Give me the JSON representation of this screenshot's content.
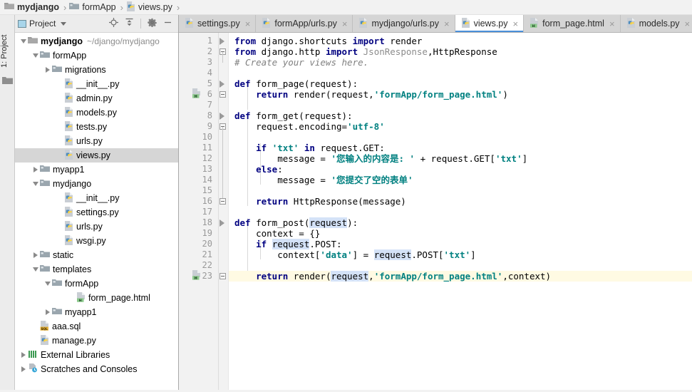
{
  "breadcrumb": {
    "items": [
      {
        "label": "mydjango",
        "icon": "folder-dark-icon"
      },
      {
        "label": "formApp",
        "icon": "folder-blue-icon"
      },
      {
        "label": "views.py",
        "icon": "python-file-icon"
      }
    ],
    "separator": "›"
  },
  "toolstrip": {
    "project_tab_label": "1: Project",
    "folder_icon": "folder-icon"
  },
  "project_panel": {
    "title": "Project",
    "tools": [
      {
        "name": "locate-icon",
        "glyph": "⊕"
      },
      {
        "name": "collapse-all-icon",
        "glyph": "⤓"
      },
      {
        "name": "settings-gear-icon",
        "glyph": "⚙"
      },
      {
        "name": "hide-panel-icon",
        "glyph": "—"
      }
    ],
    "tree": [
      {
        "label": "mydjango",
        "path": "~/django/mydjango",
        "icon": "folder-dark-icon",
        "indent": 0,
        "arrow": "down",
        "bold": true,
        "selected": false
      },
      {
        "label": "formApp",
        "path": "",
        "icon": "folder-blue-icon",
        "indent": 1,
        "arrow": "down",
        "bold": false,
        "selected": false
      },
      {
        "label": "migrations",
        "path": "",
        "icon": "folder-blue-icon",
        "indent": 2,
        "arrow": "right",
        "bold": false,
        "selected": false
      },
      {
        "label": "__init__.py",
        "path": "",
        "icon": "python-file-icon",
        "indent": 3,
        "arrow": "none",
        "bold": false,
        "selected": false
      },
      {
        "label": "admin.py",
        "path": "",
        "icon": "python-file-icon",
        "indent": 3,
        "arrow": "none",
        "bold": false,
        "selected": false
      },
      {
        "label": "models.py",
        "path": "",
        "icon": "python-file-icon",
        "indent": 3,
        "arrow": "none",
        "bold": false,
        "selected": false
      },
      {
        "label": "tests.py",
        "path": "",
        "icon": "python-file-icon",
        "indent": 3,
        "arrow": "none",
        "bold": false,
        "selected": false
      },
      {
        "label": "urls.py",
        "path": "",
        "icon": "python-file-icon",
        "indent": 3,
        "arrow": "none",
        "bold": false,
        "selected": false
      },
      {
        "label": "views.py",
        "path": "",
        "icon": "python-file-icon",
        "indent": 3,
        "arrow": "none",
        "bold": false,
        "selected": true
      },
      {
        "label": "myapp1",
        "path": "",
        "icon": "folder-blue-icon",
        "indent": 1,
        "arrow": "right",
        "bold": false,
        "selected": false
      },
      {
        "label": "mydjango",
        "path": "",
        "icon": "folder-blue-icon",
        "indent": 1,
        "arrow": "down",
        "bold": false,
        "selected": false
      },
      {
        "label": "__init__.py",
        "path": "",
        "icon": "python-file-icon",
        "indent": 3,
        "arrow": "none",
        "bold": false,
        "selected": false
      },
      {
        "label": "settings.py",
        "path": "",
        "icon": "python-file-icon",
        "indent": 3,
        "arrow": "none",
        "bold": false,
        "selected": false
      },
      {
        "label": "urls.py",
        "path": "",
        "icon": "python-file-icon",
        "indent": 3,
        "arrow": "none",
        "bold": false,
        "selected": false
      },
      {
        "label": "wsgi.py",
        "path": "",
        "icon": "python-file-icon",
        "indent": 3,
        "arrow": "none",
        "bold": false,
        "selected": false
      },
      {
        "label": "static",
        "path": "",
        "icon": "folder-blue-icon",
        "indent": 1,
        "arrow": "right",
        "bold": false,
        "selected": false
      },
      {
        "label": "templates",
        "path": "",
        "icon": "folder-blue-icon",
        "indent": 1,
        "arrow": "down",
        "bold": false,
        "selected": false
      },
      {
        "label": "formApp",
        "path": "",
        "icon": "folder-blue-icon",
        "indent": 2,
        "arrow": "down",
        "bold": false,
        "selected": false
      },
      {
        "label": "form_page.html",
        "path": "",
        "icon": "html-file-icon",
        "indent": 4,
        "arrow": "none",
        "bold": false,
        "selected": false
      },
      {
        "label": "myapp1",
        "path": "",
        "icon": "folder-blue-icon",
        "indent": 2,
        "arrow": "right",
        "bold": false,
        "selected": false
      },
      {
        "label": "aaa.sql",
        "path": "",
        "icon": "sql-file-icon",
        "indent": 1,
        "arrow": "none",
        "bold": false,
        "selected": false
      },
      {
        "label": "manage.py",
        "path": "",
        "icon": "python-file-icon",
        "indent": 1,
        "arrow": "none",
        "bold": false,
        "selected": false
      },
      {
        "label": "External Libraries",
        "path": "",
        "icon": "libraries-icon",
        "indent": 0,
        "arrow": "right",
        "bold": false,
        "selected": false
      },
      {
        "label": "Scratches and Consoles",
        "path": "",
        "icon": "scratches-icon",
        "indent": 0,
        "arrow": "right",
        "bold": false,
        "selected": false
      }
    ]
  },
  "editor": {
    "tabs": [
      {
        "label": "settings.py",
        "icon": "python-file-icon",
        "active": false,
        "close": "×"
      },
      {
        "label": "formApp/urls.py",
        "icon": "python-file-icon",
        "active": false,
        "close": "×"
      },
      {
        "label": "mydjango/urls.py",
        "icon": "python-file-icon",
        "active": false,
        "close": "×"
      },
      {
        "label": "views.py",
        "icon": "python-file-icon",
        "active": true,
        "close": "×"
      },
      {
        "label": "form_page.html",
        "icon": "html-file-icon",
        "active": false,
        "close": "×"
      },
      {
        "label": "models.py",
        "icon": "python-file-icon",
        "active": false,
        "close": "×"
      }
    ],
    "caret_line": 23,
    "line_numbers": [
      1,
      2,
      3,
      4,
      5,
      6,
      7,
      8,
      9,
      10,
      11,
      12,
      13,
      14,
      15,
      16,
      17,
      18,
      19,
      20,
      21,
      22,
      23
    ],
    "gutter_markers": [
      {
        "line": 6,
        "name": "html-navigation-marker-icon"
      },
      {
        "line": 23,
        "name": "html-navigation-marker-icon"
      },
      {
        "line": 22,
        "name": "intention-bulb-icon"
      }
    ],
    "lines": [
      {
        "n": 1,
        "tokens": [
          {
            "t": "from",
            "c": "kw"
          },
          {
            "t": " django.shortcuts ",
            "c": "plain"
          },
          {
            "t": "import",
            "c": "kw"
          },
          {
            "t": " render",
            "c": "plain"
          }
        ]
      },
      {
        "n": 2,
        "tokens": [
          {
            "t": "from",
            "c": "kw"
          },
          {
            "t": " django.http ",
            "c": "plain"
          },
          {
            "t": "import",
            "c": "kw"
          },
          {
            "t": " ",
            "c": "plain"
          },
          {
            "t": "JsonResponse",
            "c": "cls"
          },
          {
            "t": ",",
            "c": "plain"
          },
          {
            "t": "HttpResponse",
            "c": "plain"
          }
        ]
      },
      {
        "n": 3,
        "tokens": [
          {
            "t": "# Create your views here.",
            "c": "cmt"
          }
        ]
      },
      {
        "n": 4,
        "tokens": []
      },
      {
        "n": 5,
        "tokens": [
          {
            "t": "def",
            "c": "kw"
          },
          {
            "t": " form_page(request):",
            "c": "plain"
          }
        ]
      },
      {
        "n": 6,
        "tokens": [
          {
            "t": "    ",
            "c": "plain"
          },
          {
            "t": "return",
            "c": "kw"
          },
          {
            "t": " render(request,",
            "c": "plain"
          },
          {
            "t": "'formApp/form_page.html'",
            "c": "str"
          },
          {
            "t": ")",
            "c": "plain"
          }
        ]
      },
      {
        "n": 7,
        "tokens": []
      },
      {
        "n": 8,
        "tokens": [
          {
            "t": "def",
            "c": "kw"
          },
          {
            "t": " form_get(request):",
            "c": "plain"
          }
        ]
      },
      {
        "n": 9,
        "tokens": [
          {
            "t": "    request.encoding=",
            "c": "plain"
          },
          {
            "t": "'utf-8'",
            "c": "str"
          }
        ]
      },
      {
        "n": 10,
        "tokens": []
      },
      {
        "n": 11,
        "tokens": [
          {
            "t": "    ",
            "c": "plain"
          },
          {
            "t": "if",
            "c": "kw"
          },
          {
            "t": " ",
            "c": "plain"
          },
          {
            "t": "'txt'",
            "c": "str"
          },
          {
            "t": " ",
            "c": "plain"
          },
          {
            "t": "in",
            "c": "kw"
          },
          {
            "t": " request.GET:",
            "c": "plain"
          }
        ]
      },
      {
        "n": 12,
        "tokens": [
          {
            "t": "        message = ",
            "c": "plain"
          },
          {
            "t": "'您输入的内容是: '",
            "c": "str"
          },
          {
            "t": " + request.GET[",
            "c": "plain"
          },
          {
            "t": "'txt'",
            "c": "str"
          },
          {
            "t": "]",
            "c": "plain"
          }
        ]
      },
      {
        "n": 13,
        "tokens": [
          {
            "t": "    ",
            "c": "plain"
          },
          {
            "t": "else",
            "c": "kw"
          },
          {
            "t": ":",
            "c": "plain"
          }
        ]
      },
      {
        "n": 14,
        "tokens": [
          {
            "t": "        message = ",
            "c": "plain"
          },
          {
            "t": "'您提交了空的表单'",
            "c": "str"
          }
        ]
      },
      {
        "n": 15,
        "tokens": []
      },
      {
        "n": 16,
        "tokens": [
          {
            "t": "    ",
            "c": "plain"
          },
          {
            "t": "return",
            "c": "kw"
          },
          {
            "t": " HttpResponse(message)",
            "c": "plain"
          }
        ]
      },
      {
        "n": 17,
        "tokens": []
      },
      {
        "n": 18,
        "tokens": [
          {
            "t": "def",
            "c": "kw"
          },
          {
            "t": " form_post(",
            "c": "plain"
          },
          {
            "t": "request",
            "c": "hl"
          },
          {
            "t": "):",
            "c": "plain"
          }
        ]
      },
      {
        "n": 19,
        "tokens": [
          {
            "t": "    context = {}",
            "c": "plain"
          }
        ]
      },
      {
        "n": 20,
        "tokens": [
          {
            "t": "    ",
            "c": "plain"
          },
          {
            "t": "if",
            "c": "kw"
          },
          {
            "t": " ",
            "c": "plain"
          },
          {
            "t": "request",
            "c": "hl"
          },
          {
            "t": ".POST:",
            "c": "plain"
          }
        ]
      },
      {
        "n": 21,
        "tokens": [
          {
            "t": "        context[",
            "c": "plain"
          },
          {
            "t": "'data'",
            "c": "str"
          },
          {
            "t": "] = ",
            "c": "plain"
          },
          {
            "t": "request",
            "c": "hl"
          },
          {
            "t": ".POST[",
            "c": "plain"
          },
          {
            "t": "'txt'",
            "c": "str"
          },
          {
            "t": "]",
            "c": "plain"
          }
        ]
      },
      {
        "n": 22,
        "tokens": []
      },
      {
        "n": 23,
        "tokens": [
          {
            "t": "    ",
            "c": "plain"
          },
          {
            "t": "return",
            "c": "kw"
          },
          {
            "t": " render(",
            "c": "plain"
          },
          {
            "t": "request",
            "c": "hl"
          },
          {
            "t": ",",
            "c": "plain"
          },
          {
            "t": "'formApp/form_page.html'",
            "c": "str"
          },
          {
            "t": ",context)",
            "c": "plain"
          }
        ]
      }
    ]
  },
  "colors": {
    "keyword": "#000080",
    "string": "#008080",
    "comment": "#808080",
    "class_ref": "#8c8c8c",
    "caret_line_bg": "#fffae3",
    "identifier_highlight": "#d4e2f7",
    "tab_active_underline": "#4a90d9",
    "selection_bg": "#d6d6d6"
  }
}
